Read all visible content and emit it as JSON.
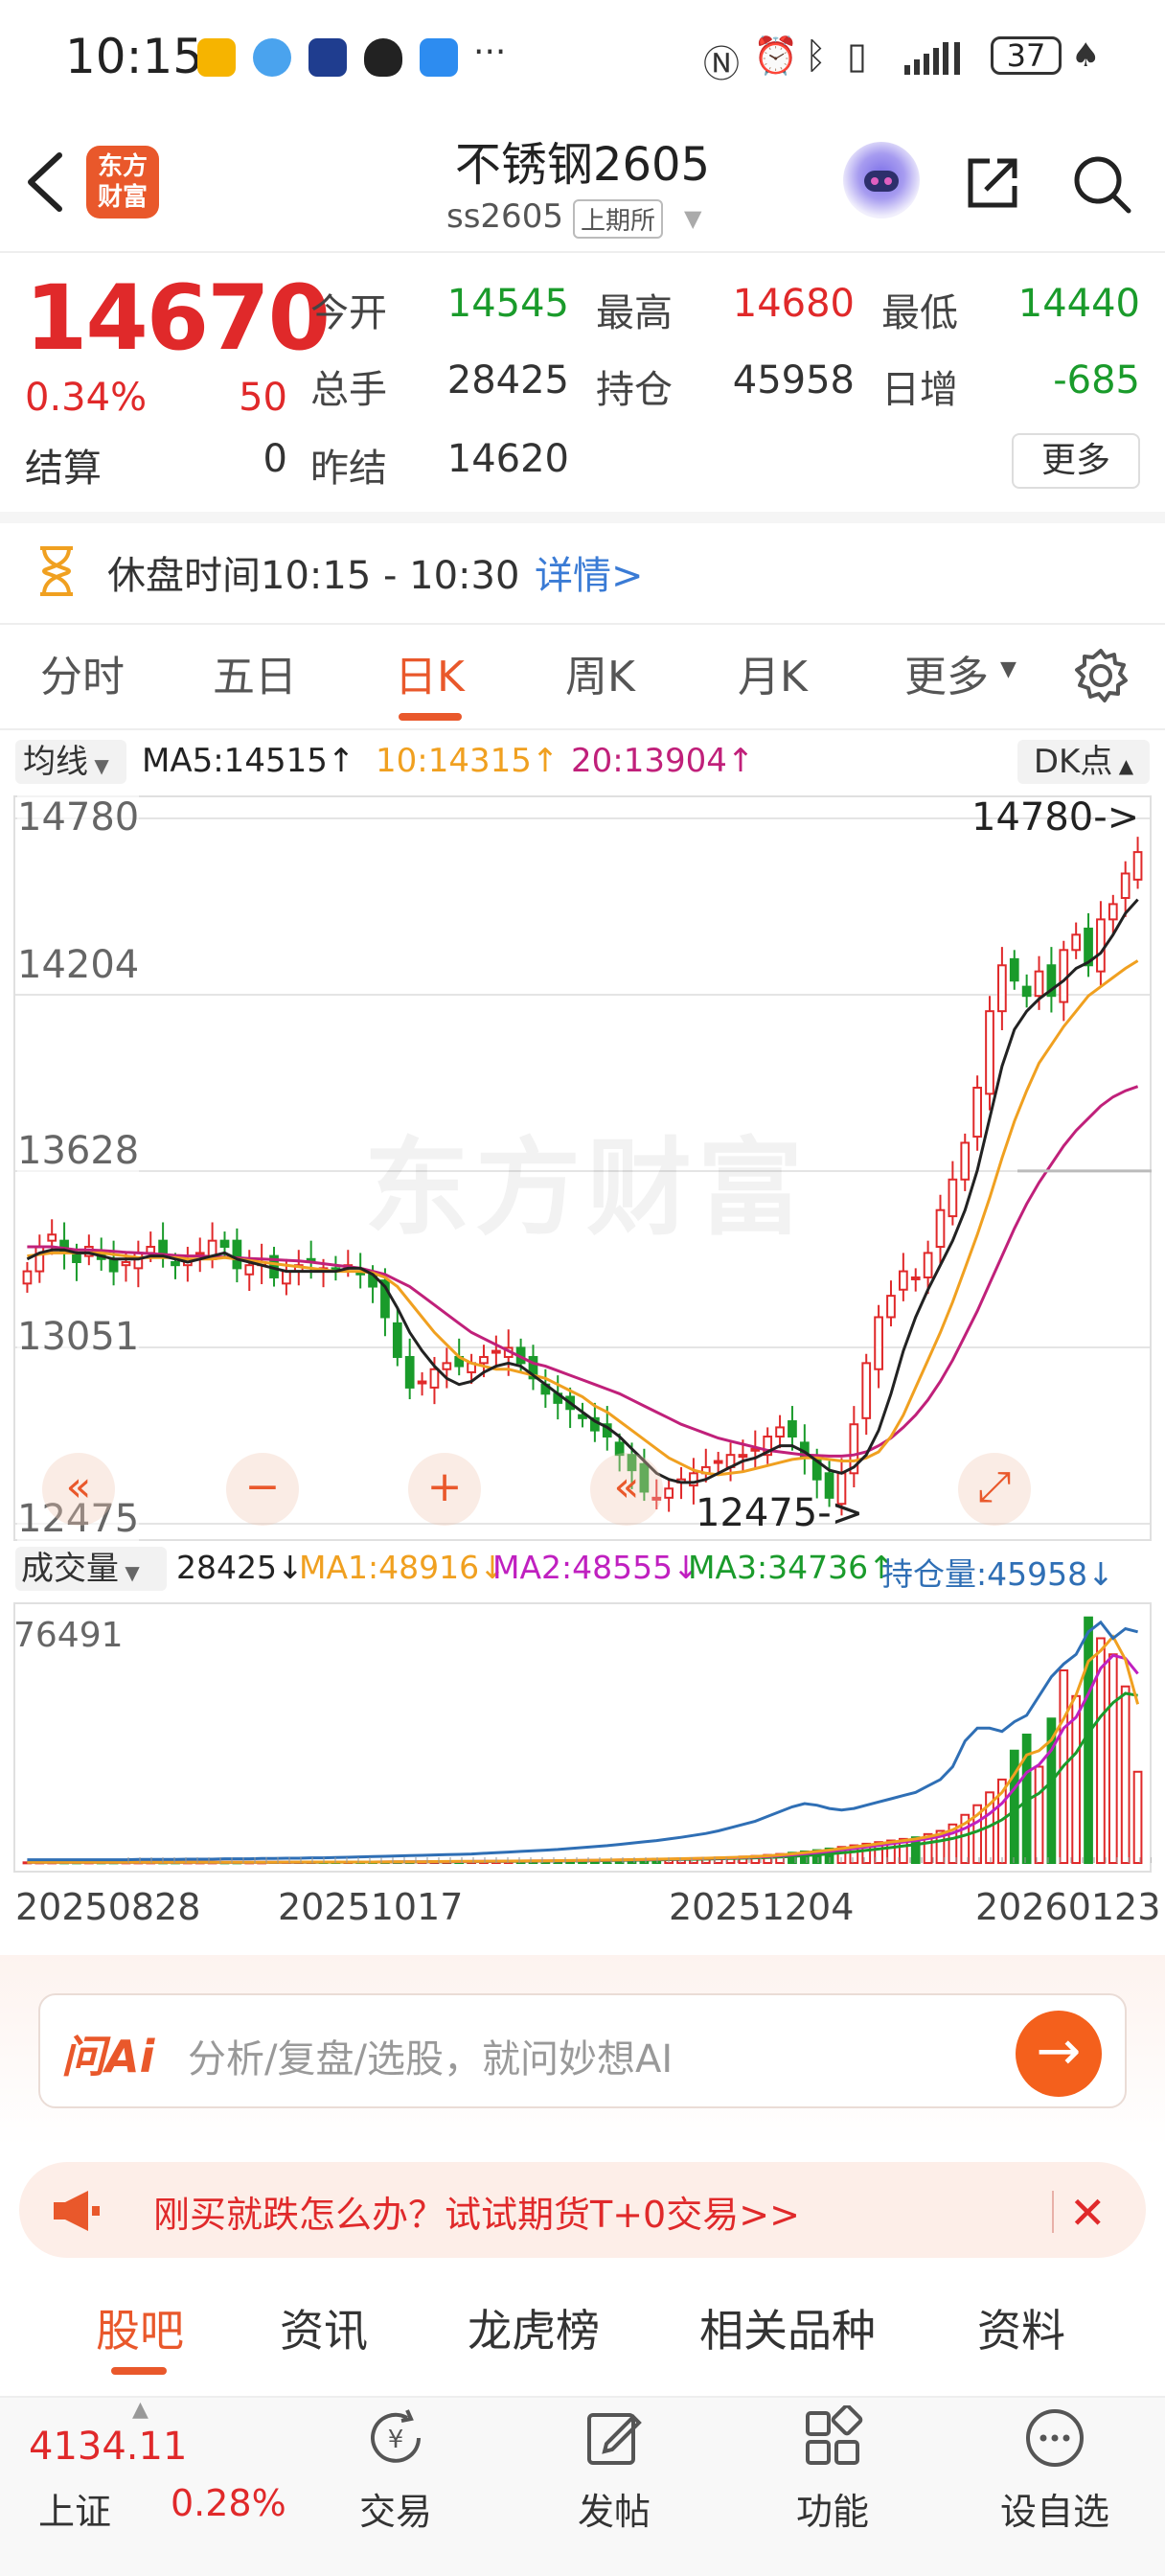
{
  "status_bar": {
    "time": "10:15",
    "battery": "37"
  },
  "header": {
    "title": "不锈钢2605",
    "code": "ss2605",
    "exchange": "上期所",
    "logo_text": "东方\n财富"
  },
  "quote": {
    "price": "14670",
    "change_pct": "0.34%",
    "change": "50",
    "settle_label": "结算",
    "settle": "0",
    "open_label": "今开",
    "open": "14545",
    "high_label": "最高",
    "high": "14680",
    "low_label": "最低",
    "low": "14440",
    "vol_label": "总手",
    "vol": "28425",
    "oi_label": "持仓",
    "oi": "45958",
    "inc_label": "日增",
    "inc": "-685",
    "prev_label": "昨结",
    "prev": "14620",
    "more_label": "更多"
  },
  "break_bar": {
    "text": "休盘时间10:15 - 10:30",
    "detail": "详情>"
  },
  "tabs": [
    "分时",
    "五日",
    "日K",
    "周K",
    "月K",
    "更多"
  ],
  "ma_row": {
    "btn": "均线",
    "ma5": "MA5:14515↑",
    "ma10": "10:14315↑",
    "ma20": "20:13904↑",
    "dk": "DK点"
  },
  "chart_data": [
    {
      "type": "candlestick",
      "y_ticks": [
        "14780",
        "14204",
        "13628",
        "13051",
        "12475"
      ],
      "ylim": [
        12475,
        14780
      ],
      "annotations": [
        "14780->",
        "12475->"
      ],
      "watermark": "东方财富",
      "series_colors": {
        "ma5": "#222222",
        "ma10": "#f0a020",
        "ma20": "#c0207a",
        "up": "#e0292a",
        "down": "#1a9b2b"
      },
      "closes": [
        13300,
        13380,
        13420,
        13360,
        13330,
        13380,
        13340,
        13300,
        13330,
        13360,
        13380,
        13350,
        13320,
        13340,
        13360,
        13400,
        13380,
        13310,
        13320,
        13330,
        13280,
        13300,
        13320,
        13330,
        13310,
        13300,
        13320,
        13290,
        13250,
        13150,
        13020,
        12920,
        12940,
        12980,
        13000,
        12990,
        13000,
        13020,
        13040,
        13050,
        13000,
        12950,
        12900,
        12870,
        12850,
        12820,
        12780,
        12760,
        12700,
        12650,
        12580,
        12560,
        12590,
        12620,
        12640,
        12660,
        12680,
        12700,
        12700,
        12720,
        12760,
        12790,
        12760,
        12690,
        12620,
        12560,
        12640,
        12800,
        13000,
        13150,
        13220,
        13300,
        13280,
        13360,
        13500,
        13600,
        13720,
        13900,
        14150,
        14300,
        14250,
        14200,
        14280,
        14200,
        14350,
        14400,
        14300,
        14450,
        14500,
        14600,
        14670
      ],
      "ma5": [
        13340,
        13360,
        13370,
        13370,
        13360,
        13360,
        13350,
        13340,
        13340,
        13340,
        13350,
        13350,
        13340,
        13330,
        13340,
        13350,
        13360,
        13340,
        13330,
        13320,
        13310,
        13300,
        13300,
        13300,
        13300,
        13300,
        13310,
        13310,
        13290,
        13250,
        13180,
        13100,
        13040,
        12990,
        12950,
        12930,
        12940,
        12970,
        12990,
        13000,
        12990,
        12960,
        12930,
        12900,
        12870,
        12840,
        12810,
        12790,
        12760,
        12720,
        12680,
        12640,
        12620,
        12610,
        12610,
        12620,
        12640,
        12660,
        12680,
        12690,
        12710,
        12730,
        12730,
        12710,
        12680,
        12650,
        12640,
        12660,
        12700,
        12780,
        12900,
        13040,
        13150,
        13240,
        13320,
        13400,
        13500,
        13630,
        13800,
        13970,
        14090,
        14150,
        14190,
        14220,
        14250,
        14290,
        14310,
        14340,
        14400,
        14470,
        14515
      ],
      "ma10": [
        13350,
        13355,
        13360,
        13360,
        13360,
        13360,
        13360,
        13355,
        13350,
        13345,
        13345,
        13345,
        13345,
        13340,
        13340,
        13340,
        13345,
        13340,
        13335,
        13330,
        13325,
        13320,
        13315,
        13310,
        13305,
        13300,
        13300,
        13300,
        13295,
        13280,
        13250,
        13200,
        13150,
        13100,
        13060,
        13020,
        13000,
        12990,
        12980,
        12980,
        12970,
        12960,
        12950,
        12930,
        12910,
        12890,
        12860,
        12840,
        12810,
        12780,
        12750,
        12720,
        12690,
        12670,
        12650,
        12640,
        12635,
        12640,
        12645,
        12655,
        12665,
        12675,
        12685,
        12690,
        12690,
        12685,
        12680,
        12680,
        12690,
        12710,
        12760,
        12830,
        12920,
        13010,
        13100,
        13200,
        13310,
        13420,
        13540,
        13670,
        13790,
        13890,
        13980,
        14040,
        14100,
        14150,
        14200,
        14230,
        14260,
        14290,
        14315
      ],
      "ma20": [
        13380,
        13380,
        13380,
        13375,
        13370,
        13370,
        13368,
        13365,
        13362,
        13360,
        13358,
        13355,
        13352,
        13350,
        13350,
        13348,
        13346,
        13344,
        13342,
        13340,
        13338,
        13336,
        13334,
        13330,
        13325,
        13320,
        13315,
        13310,
        13300,
        13290,
        13270,
        13250,
        13220,
        13190,
        13160,
        13130,
        13100,
        13080,
        13060,
        13040,
        13020,
        13000,
        12990,
        12975,
        12960,
        12945,
        12930,
        12915,
        12900,
        12880,
        12860,
        12840,
        12820,
        12800,
        12785,
        12770,
        12755,
        12745,
        12735,
        12725,
        12715,
        12710,
        12705,
        12700,
        12698,
        12696,
        12696,
        12700,
        12710,
        12730,
        12755,
        12790,
        12830,
        12880,
        12940,
        13010,
        13090,
        13170,
        13260,
        13350,
        13440,
        13520,
        13590,
        13650,
        13710,
        13760,
        13800,
        13840,
        13870,
        13890,
        13904
      ]
    },
    {
      "type": "bar",
      "title": "成交量",
      "ymax_label": "76491",
      "x_labels": [
        "20250828",
        "20251017",
        "20251204",
        "20260123"
      ],
      "legend": {
        "vol": "28425↓",
        "ma1": "MA1:48916↓",
        "ma2": "MA2:48555↓",
        "ma3": "MA3:34736↑",
        "oi": "持仓量:45958↓"
      },
      "series_colors": {
        "ma1": "#f0a020",
        "ma2": "#c020c0",
        "ma3": "#1a9b2b",
        "oi": "#2f6fb5"
      },
      "volume": [
        200,
        200,
        200,
        200,
        200,
        200,
        200,
        200,
        200,
        200,
        200,
        200,
        200,
        200,
        200,
        200,
        200,
        200,
        200,
        200,
        300,
        300,
        300,
        300,
        300,
        300,
        300,
        300,
        300,
        400,
        400,
        400,
        400,
        500,
        500,
        500,
        500,
        600,
        600,
        600,
        700,
        700,
        700,
        800,
        800,
        900,
        900,
        1000,
        1000,
        1100,
        1200,
        1300,
        1300,
        1400,
        1500,
        1600,
        1700,
        1800,
        2000,
        2200,
        2500,
        2800,
        3200,
        3600,
        4000,
        4500,
        5000,
        5500,
        6000,
        6500,
        7000,
        7500,
        8000,
        9000,
        10000,
        12000,
        15000,
        18000,
        22000,
        26000,
        35000,
        40000,
        30000,
        45000,
        60000,
        52000,
        76491,
        70000,
        65000,
        55000,
        28425
      ],
      "oi": [
        1000,
        1000,
        1000,
        1000,
        1000,
        1000,
        1000,
        1000,
        1000,
        1100,
        1100,
        1100,
        1100,
        1200,
        1200,
        1200,
        1300,
        1300,
        1300,
        1400,
        1400,
        1500,
        1500,
        1600,
        1600,
        1700,
        1800,
        1900,
        2000,
        2100,
        2200,
        2300,
        2400,
        2500,
        2600,
        2700,
        2800,
        3000,
        3200,
        3400,
        3600,
        3800,
        4000,
        4200,
        4500,
        4800,
        5100,
        5400,
        5800,
        6200,
        6600,
        7000,
        7500,
        8000,
        8600,
        9200,
        10000,
        11000,
        12000,
        13000,
        14500,
        16000,
        17500,
        18500,
        18000,
        17000,
        16500,
        17000,
        18000,
        19000,
        20000,
        21000,
        22000,
        24000,
        26000,
        30000,
        38000,
        42000,
        42000,
        41000,
        44000,
        46000,
        52000,
        58000,
        62000,
        65000,
        72000,
        75000,
        70000,
        73000,
        72000
      ]
    }
  ],
  "volume_row": {
    "btn": "成交量"
  },
  "ai_bar": {
    "logo": "问Ai",
    "placeholder": "分析/复盘/选股，就问妙想AI"
  },
  "promo": {
    "text": "刚买就跌怎么办？试试期货T+0交易>>"
  },
  "bottom_tabs": [
    "股吧",
    "资讯",
    "龙虎榜",
    "相关品种",
    "资料"
  ],
  "index": {
    "value": "4134.11",
    "name": "上证",
    "pct": "0.28%"
  },
  "nav": [
    "交易",
    "发帖",
    "功能",
    "设自选"
  ]
}
